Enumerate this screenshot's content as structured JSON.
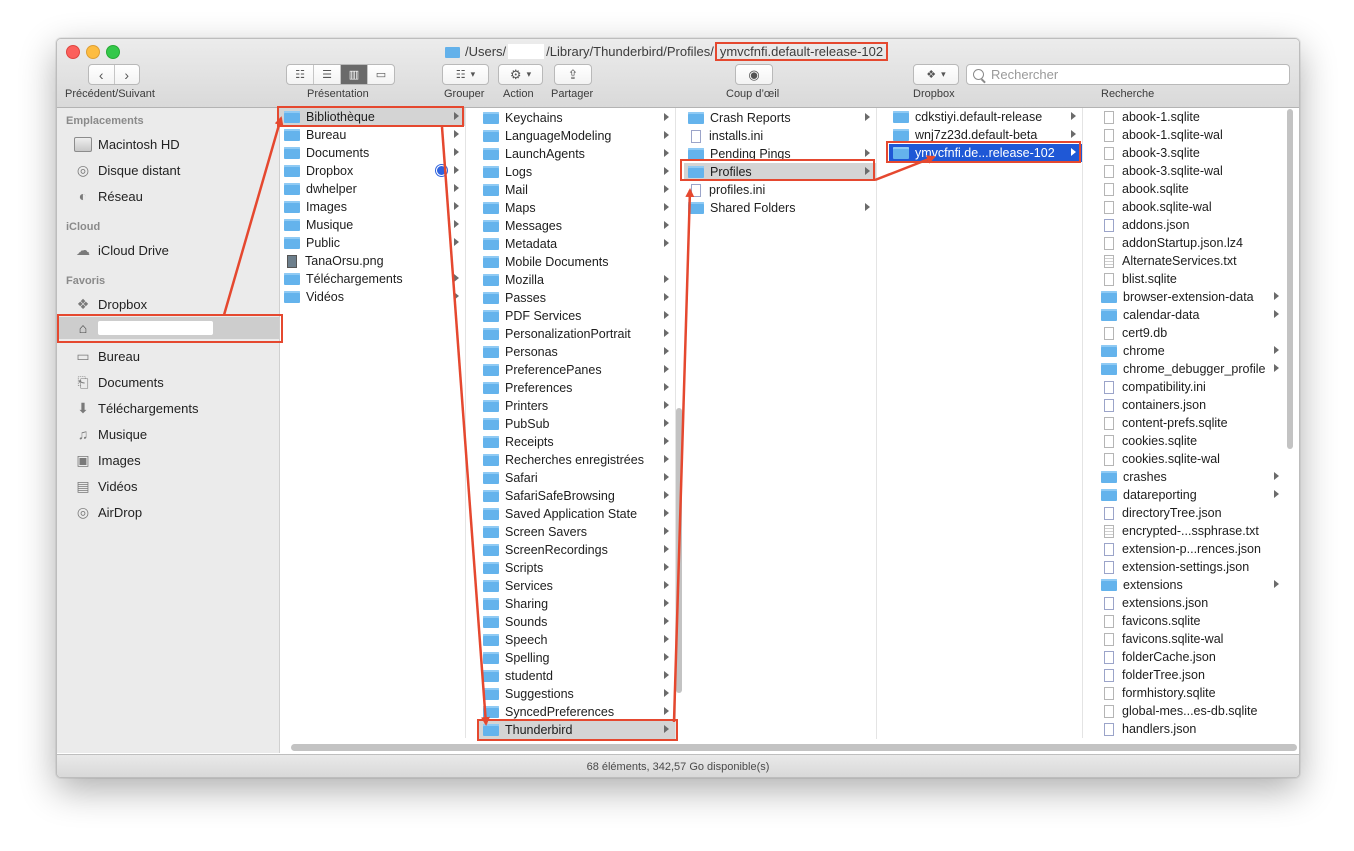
{
  "titlebar": {
    "path_prefix": "/Users/",
    "path_middle": "/Library/Thunderbird/Profiles/",
    "path_current": "ymvcfnfi.default-release-102"
  },
  "toolbar": {
    "back_icon": "chevron-left-icon",
    "forward_icon": "chevron-right-icon",
    "nav_label": "Précédent/Suivant",
    "view_label": "Présentation",
    "group_label": "Grouper",
    "action_label": "Action",
    "share_label": "Partager",
    "quicklook_label": "Coup d’œil",
    "dropbox_label": "Dropbox",
    "search_label": "Recherche",
    "search_placeholder": "Rechercher"
  },
  "sidebar": {
    "sections": [
      {
        "title": "Emplacements",
        "items": [
          {
            "label": "Macintosh HD",
            "icon": "disk-icon"
          },
          {
            "label": "Disque distant",
            "icon": "disc-icon"
          },
          {
            "label": "Réseau",
            "icon": "globe-icon"
          }
        ]
      },
      {
        "title": "iCloud",
        "items": [
          {
            "label": "iCloud Drive",
            "icon": "cloud-icon"
          }
        ]
      },
      {
        "title": "Favoris",
        "items": [
          {
            "label": "Dropbox",
            "icon": "dropbox-icon"
          },
          {
            "label": "",
            "icon": "home-icon",
            "selected": true
          },
          {
            "label": "Bureau",
            "icon": "desktop-icon"
          },
          {
            "label": "Documents",
            "icon": "document-icon"
          },
          {
            "label": "Téléchargements",
            "icon": "download-icon"
          },
          {
            "label": "Musique",
            "icon": "music-icon"
          },
          {
            "label": "Images",
            "icon": "camera-icon"
          },
          {
            "label": "Vidéos",
            "icon": "film-icon"
          },
          {
            "label": "AirDrop",
            "icon": "airdrop-icon"
          }
        ]
      }
    ]
  },
  "columns": [
    {
      "items": [
        {
          "name": "Bibliothèque",
          "type": "folder",
          "arrow": true,
          "state": "gray"
        },
        {
          "name": "Bureau",
          "type": "folder",
          "arrow": true
        },
        {
          "name": "Documents",
          "type": "folder",
          "arrow": true
        },
        {
          "name": "Dropbox",
          "type": "dropbox",
          "arrow": true,
          "badge": true
        },
        {
          "name": "dwhelper",
          "type": "folder",
          "arrow": true
        },
        {
          "name": "Images",
          "type": "folder",
          "arrow": true
        },
        {
          "name": "Musique",
          "type": "folder",
          "arrow": true
        },
        {
          "name": "Public",
          "type": "folder",
          "arrow": true
        },
        {
          "name": "TanaOrsu.png",
          "type": "image"
        },
        {
          "name": "Téléchargements",
          "type": "folder",
          "arrow": true
        },
        {
          "name": "Vidéos",
          "type": "folder",
          "arrow": true
        }
      ]
    },
    {
      "items": [
        {
          "name": "Keychains",
          "type": "folder",
          "arrow": true
        },
        {
          "name": "LanguageModeling",
          "type": "folder",
          "arrow": true
        },
        {
          "name": "LaunchAgents",
          "type": "folder",
          "arrow": true
        },
        {
          "name": "Logs",
          "type": "folder",
          "arrow": true
        },
        {
          "name": "Mail",
          "type": "folder",
          "arrow": true
        },
        {
          "name": "Maps",
          "type": "folder",
          "arrow": true
        },
        {
          "name": "Messages",
          "type": "folder",
          "arrow": true
        },
        {
          "name": "Metadata",
          "type": "folder",
          "arrow": true
        },
        {
          "name": "Mobile Documents",
          "type": "folder"
        },
        {
          "name": "Mozilla",
          "type": "folder",
          "arrow": true
        },
        {
          "name": "Passes",
          "type": "folder",
          "arrow": true
        },
        {
          "name": "PDF Services",
          "type": "folder",
          "arrow": true
        },
        {
          "name": "PersonalizationPortrait",
          "type": "folder",
          "arrow": true
        },
        {
          "name": "Personas",
          "type": "folder",
          "arrow": true
        },
        {
          "name": "PreferencePanes",
          "type": "folder",
          "arrow": true
        },
        {
          "name": "Preferences",
          "type": "folder",
          "arrow": true
        },
        {
          "name": "Printers",
          "type": "folder",
          "arrow": true
        },
        {
          "name": "PubSub",
          "type": "folder",
          "arrow": true
        },
        {
          "name": "Receipts",
          "type": "folder",
          "arrow": true
        },
        {
          "name": "Recherches enregistrées",
          "type": "folder",
          "arrow": true
        },
        {
          "name": "Safari",
          "type": "folder",
          "arrow": true
        },
        {
          "name": "SafariSafeBrowsing",
          "type": "folder",
          "arrow": true
        },
        {
          "name": "Saved Application State",
          "type": "folder",
          "arrow": true
        },
        {
          "name": "Screen Savers",
          "type": "folder",
          "arrow": true
        },
        {
          "name": "ScreenRecordings",
          "type": "folder",
          "arrow": true
        },
        {
          "name": "Scripts",
          "type": "folder",
          "arrow": true
        },
        {
          "name": "Services",
          "type": "folder",
          "arrow": true
        },
        {
          "name": "Sharing",
          "type": "folder",
          "arrow": true
        },
        {
          "name": "Sounds",
          "type": "folder",
          "arrow": true
        },
        {
          "name": "Speech",
          "type": "folder",
          "arrow": true
        },
        {
          "name": "Spelling",
          "type": "folder",
          "arrow": true
        },
        {
          "name": "studentd",
          "type": "folder",
          "arrow": true
        },
        {
          "name": "Suggestions",
          "type": "folder",
          "arrow": true
        },
        {
          "name": "SyncedPreferences",
          "type": "folder",
          "arrow": true
        },
        {
          "name": "Thunderbird",
          "type": "folder",
          "arrow": true,
          "state": "gray"
        }
      ]
    },
    {
      "items": [
        {
          "name": "Crash Reports",
          "type": "folder",
          "arrow": true
        },
        {
          "name": "installs.ini",
          "type": "config"
        },
        {
          "name": "Pending Pings",
          "type": "folder",
          "arrow": true
        },
        {
          "name": "Profiles",
          "type": "folder",
          "arrow": true,
          "state": "gray"
        },
        {
          "name": "profiles.ini",
          "type": "config"
        },
        {
          "name": "Shared Folders",
          "type": "folder",
          "arrow": true
        }
      ]
    },
    {
      "items": [
        {
          "name": "cdkstiyi.default-release",
          "type": "folder",
          "arrow": true
        },
        {
          "name": "wnj7z23d.default-beta",
          "type": "folder",
          "arrow": true
        },
        {
          "name": "ymvcfnfi.de...release-102",
          "type": "folder",
          "arrow": true,
          "state": "blue"
        }
      ]
    },
    {
      "items": [
        {
          "name": "abook-1.sqlite",
          "type": "file"
        },
        {
          "name": "abook-1.sqlite-wal",
          "type": "file"
        },
        {
          "name": "abook-3.sqlite",
          "type": "file"
        },
        {
          "name": "abook-3.sqlite-wal",
          "type": "file"
        },
        {
          "name": "abook.sqlite",
          "type": "file"
        },
        {
          "name": "abook.sqlite-wal",
          "type": "file"
        },
        {
          "name": "addons.json",
          "type": "config"
        },
        {
          "name": "addonStartup.json.lz4",
          "type": "file"
        },
        {
          "name": "AlternateServices.txt",
          "type": "text"
        },
        {
          "name": "blist.sqlite",
          "type": "file"
        },
        {
          "name": "browser-extension-data",
          "type": "folder",
          "arrow": true
        },
        {
          "name": "calendar-data",
          "type": "folder",
          "arrow": true
        },
        {
          "name": "cert9.db",
          "type": "file"
        },
        {
          "name": "chrome",
          "type": "folder",
          "arrow": true
        },
        {
          "name": "chrome_debugger_profile",
          "type": "folder",
          "arrow": true
        },
        {
          "name": "compatibility.ini",
          "type": "config"
        },
        {
          "name": "containers.json",
          "type": "config"
        },
        {
          "name": "content-prefs.sqlite",
          "type": "file"
        },
        {
          "name": "cookies.sqlite",
          "type": "file"
        },
        {
          "name": "cookies.sqlite-wal",
          "type": "file"
        },
        {
          "name": "crashes",
          "type": "folder",
          "arrow": true
        },
        {
          "name": "datareporting",
          "type": "folder",
          "arrow": true
        },
        {
          "name": "directoryTree.json",
          "type": "config"
        },
        {
          "name": "encrypted-...ssphrase.txt",
          "type": "text"
        },
        {
          "name": "extension-p...rences.json",
          "type": "config"
        },
        {
          "name": "extension-settings.json",
          "type": "config"
        },
        {
          "name": "extensions",
          "type": "folder",
          "arrow": true
        },
        {
          "name": "extensions.json",
          "type": "config"
        },
        {
          "name": "favicons.sqlite",
          "type": "file"
        },
        {
          "name": "favicons.sqlite-wal",
          "type": "file"
        },
        {
          "name": "folderCache.json",
          "type": "config"
        },
        {
          "name": "folderTree.json",
          "type": "config"
        },
        {
          "name": "formhistory.sqlite",
          "type": "file"
        },
        {
          "name": "global-mes...es-db.sqlite",
          "type": "file"
        },
        {
          "name": "handlers.json",
          "type": "config"
        }
      ]
    }
  ],
  "status": "68 éléments, 342,57 Go disponible(s)",
  "colors": {
    "annotation": "#e5482f",
    "selection_blue": "#1f58d6",
    "folder": "#64b3ec"
  }
}
